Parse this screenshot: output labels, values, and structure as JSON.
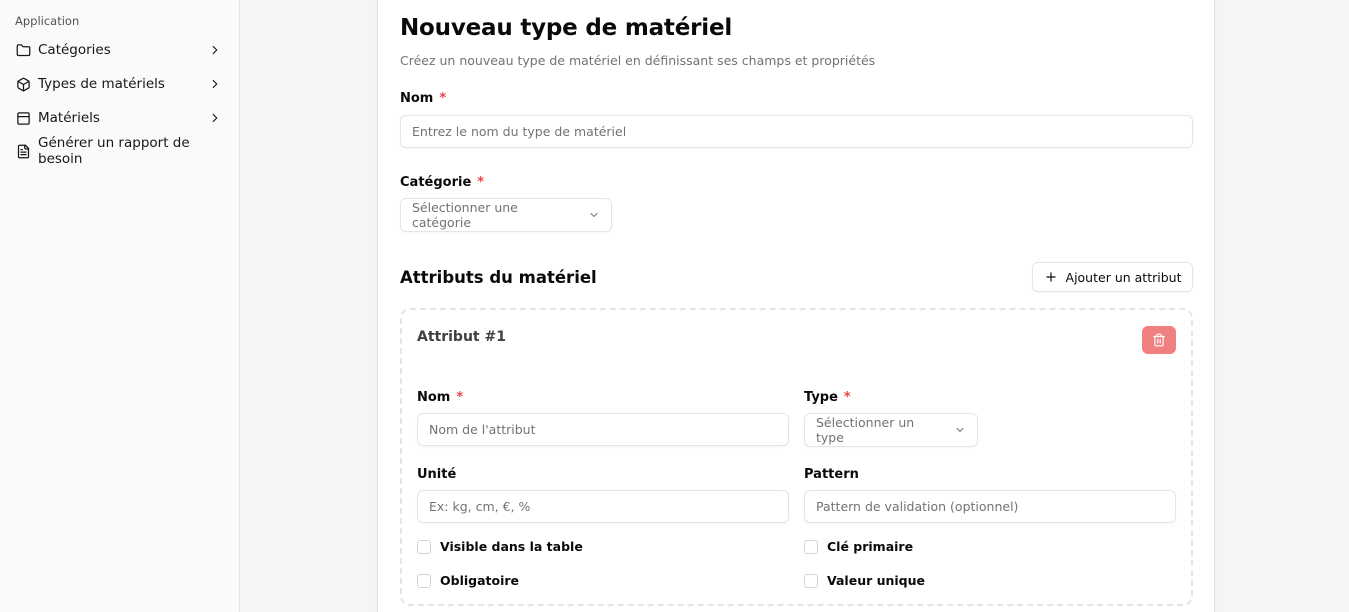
{
  "sidebar": {
    "group_label": "Application",
    "items": [
      {
        "label": "Catégories",
        "icon": "folder-icon",
        "has_submenu": true
      },
      {
        "label": "Types de matériels",
        "icon": "box-icon",
        "has_submenu": true
      },
      {
        "label": "Matériels",
        "icon": "archive-icon",
        "has_submenu": true
      },
      {
        "label": "Générer un rapport de besoin",
        "icon": "file-text-icon",
        "has_submenu": false
      }
    ]
  },
  "form": {
    "title": "Nouveau type de matériel",
    "subtitle": "Créez un nouveau type de matériel en définissant ses champs et propriétés",
    "name_label": "Nom",
    "name_required": "*",
    "name_placeholder": "Entrez le nom du type de matériel",
    "name_value": "",
    "category_label": "Catégorie",
    "category_required": "*",
    "category_placeholder": "Sélectionner une catégorie",
    "attributes_title": "Attributs du matériel",
    "add_attribute_label": "Ajouter un attribut"
  },
  "attribute": {
    "title": "Attribut #1",
    "name_label": "Nom",
    "name_required": "*",
    "name_placeholder": "Nom de l'attribut",
    "type_label": "Type",
    "type_required": "*",
    "type_placeholder": "Sélectionner un type",
    "unit_label": "Unité",
    "unit_placeholder": "Ex: kg, cm, €, %",
    "pattern_label": "Pattern",
    "pattern_placeholder": "Pattern de validation (optionnel)",
    "checks": {
      "visible": {
        "label": "Visible dans la table",
        "checked": false
      },
      "primary": {
        "label": "Clé primaire",
        "checked": false
      },
      "required": {
        "label": "Obligatoire",
        "checked": false
      },
      "unique": {
        "label": "Valeur unique",
        "checked": false
      }
    }
  },
  "colors": {
    "required": "#ef4444",
    "delete_button": "#f08080",
    "border": "#e5e5e5",
    "muted_text": "#737373"
  }
}
